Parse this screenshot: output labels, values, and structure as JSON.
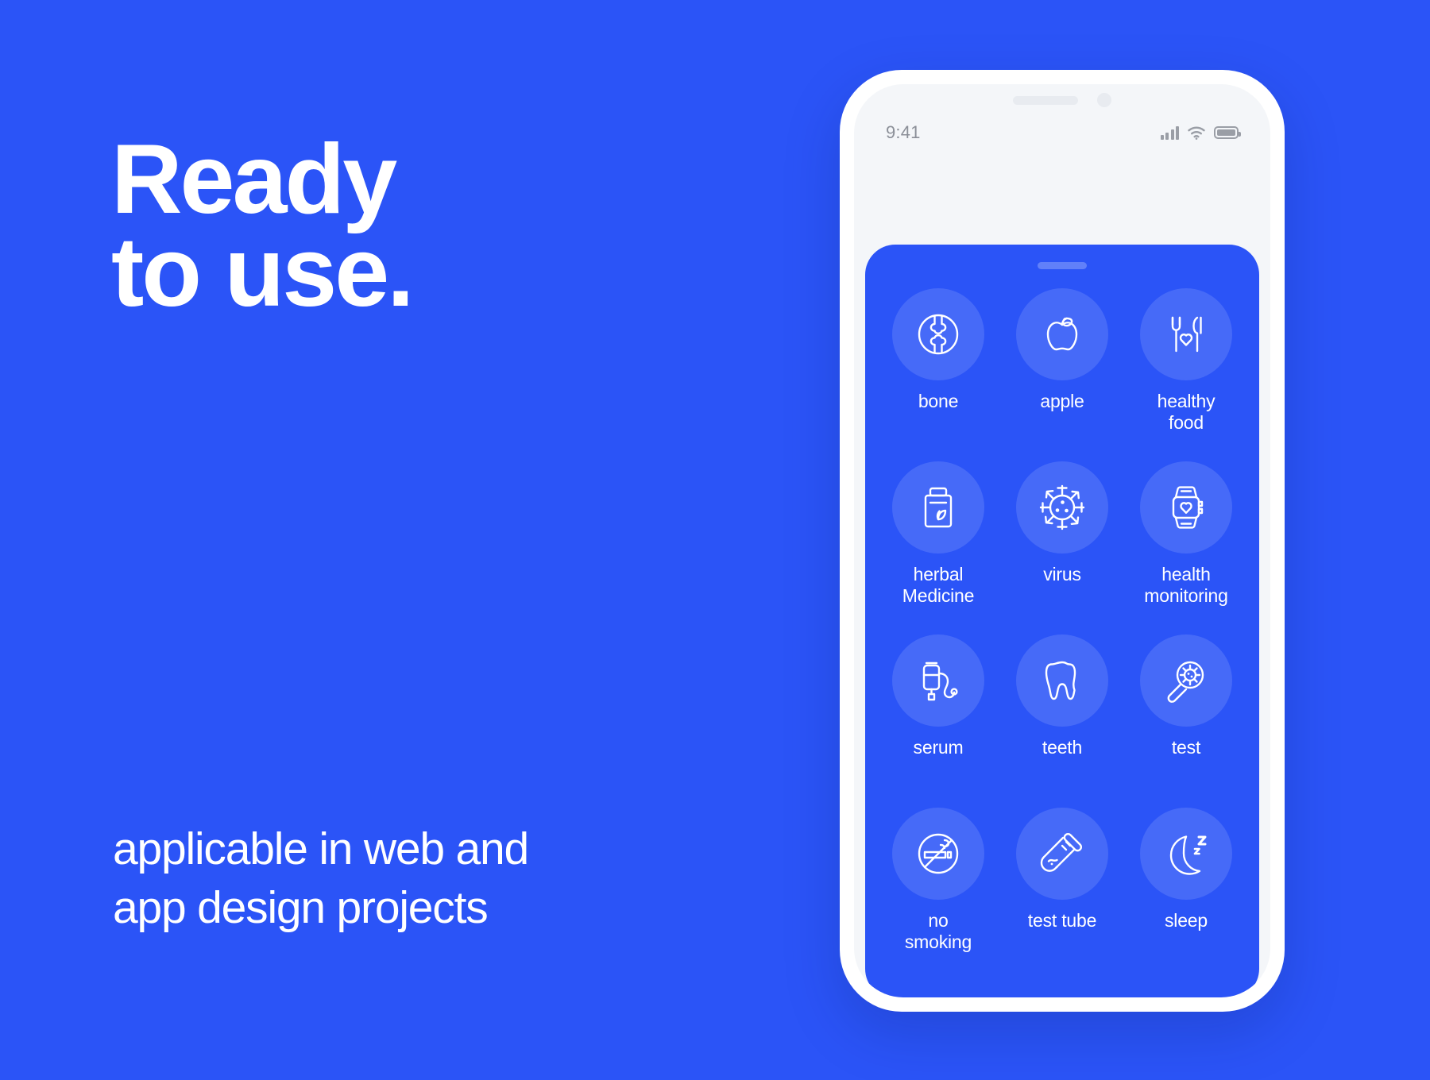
{
  "promo": {
    "headline": "Ready\nto use.",
    "subline": "applicable in web and\napp design projects",
    "background_color": "#2b54f7",
    "text_color": "#ffffff"
  },
  "phone": {
    "frame_color": "#ffffff",
    "screen_color": "#f4f6f9",
    "status_bar": {
      "time": "9:41",
      "icons": [
        "cellular-signal-icon",
        "wifi-icon",
        "battery-icon"
      ]
    },
    "sheet": {
      "background_color": "#2b54f7",
      "handle": "drag-handle",
      "icons": [
        {
          "id": "bone",
          "label": "bone",
          "icon": "bone-icon"
        },
        {
          "id": "apple",
          "label": "apple",
          "icon": "apple-icon"
        },
        {
          "id": "healthy-food",
          "label": "healthy\nfood",
          "icon": "fork-knife-heart-icon"
        },
        {
          "id": "herbal-medicine",
          "label": "herbal\nMedicine",
          "icon": "herbal-jar-icon"
        },
        {
          "id": "virus",
          "label": "virus",
          "icon": "virus-icon"
        },
        {
          "id": "health-monitoring",
          "label": "health\nmonitoring",
          "icon": "smartwatch-heart-icon"
        },
        {
          "id": "serum",
          "label": "serum",
          "icon": "iv-drip-icon"
        },
        {
          "id": "teeth",
          "label": "teeth",
          "icon": "tooth-icon"
        },
        {
          "id": "test",
          "label": "test",
          "icon": "magnifier-germ-icon"
        },
        {
          "id": "no-smoking",
          "label": "no\nsmoking",
          "icon": "no-smoking-icon"
        },
        {
          "id": "test-tube",
          "label": "test tube",
          "icon": "test-tube-icon"
        },
        {
          "id": "sleep",
          "label": "sleep",
          "icon": "moon-zzz-icon"
        }
      ]
    }
  }
}
